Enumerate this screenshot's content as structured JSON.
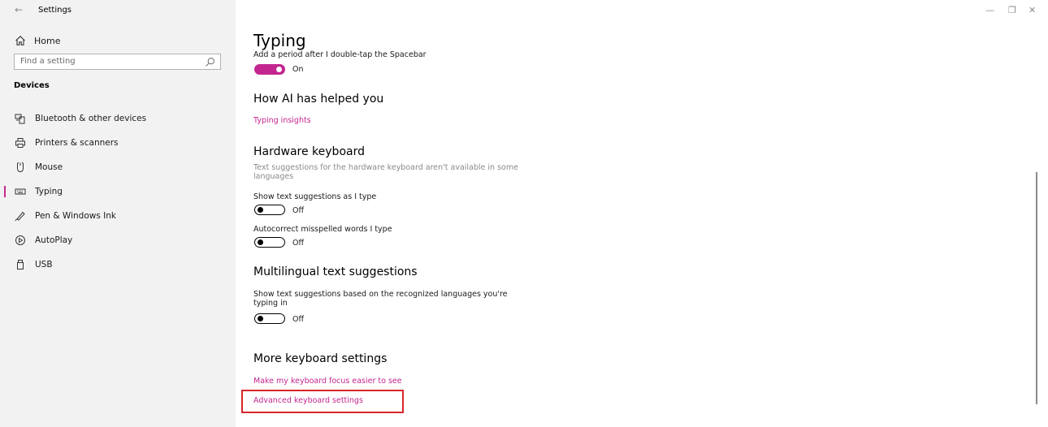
{
  "window": {
    "title": "Settings",
    "back_glyph": "←",
    "minimize_glyph": "—",
    "restore_glyph": "❐",
    "close_glyph": "✕"
  },
  "sidebar": {
    "home_label": "Home",
    "search_placeholder": "Find a setting",
    "section_label": "Devices",
    "items": [
      {
        "label": "Bluetooth & other devices",
        "icon": "bluetooth-devices-icon"
      },
      {
        "label": "Printers & scanners",
        "icon": "printer-icon"
      },
      {
        "label": "Mouse",
        "icon": "mouse-icon"
      },
      {
        "label": "Typing",
        "icon": "keyboard-icon",
        "selected": true
      },
      {
        "label": "Pen & Windows Ink",
        "icon": "pen-icon"
      },
      {
        "label": "AutoPlay",
        "icon": "autoplay-icon"
      },
      {
        "label": "USB",
        "icon": "usb-icon"
      }
    ]
  },
  "main": {
    "title": "Typing",
    "period": {
      "label": "Add a period after I double-tap the Spacebar",
      "state": "On"
    },
    "ai": {
      "heading": "How AI has helped you",
      "link": "Typing insights"
    },
    "hardware": {
      "heading": "Hardware keyboard",
      "desc1": "Text suggestions for the hardware keyboard aren't available in some",
      "desc2": "languages",
      "suggest_label": "Show text suggestions as I type",
      "suggest_state": "Off",
      "autocorrect_label": "Autocorrect misspelled words I type",
      "autocorrect_state": "Off"
    },
    "multilingual": {
      "heading": "Multilingual text suggestions",
      "desc1": "Show text suggestions based on the recognized languages you're",
      "desc2": "typing in",
      "state": "Off"
    },
    "more": {
      "heading": "More keyboard settings",
      "focus_link": "Make my keyboard focus easier to see",
      "advanced_link": "Advanced keyboard settings"
    }
  },
  "colors": {
    "accent": "#c3268f",
    "highlight": "#d8262b",
    "sidebar_bg": "#f2f2f2"
  }
}
